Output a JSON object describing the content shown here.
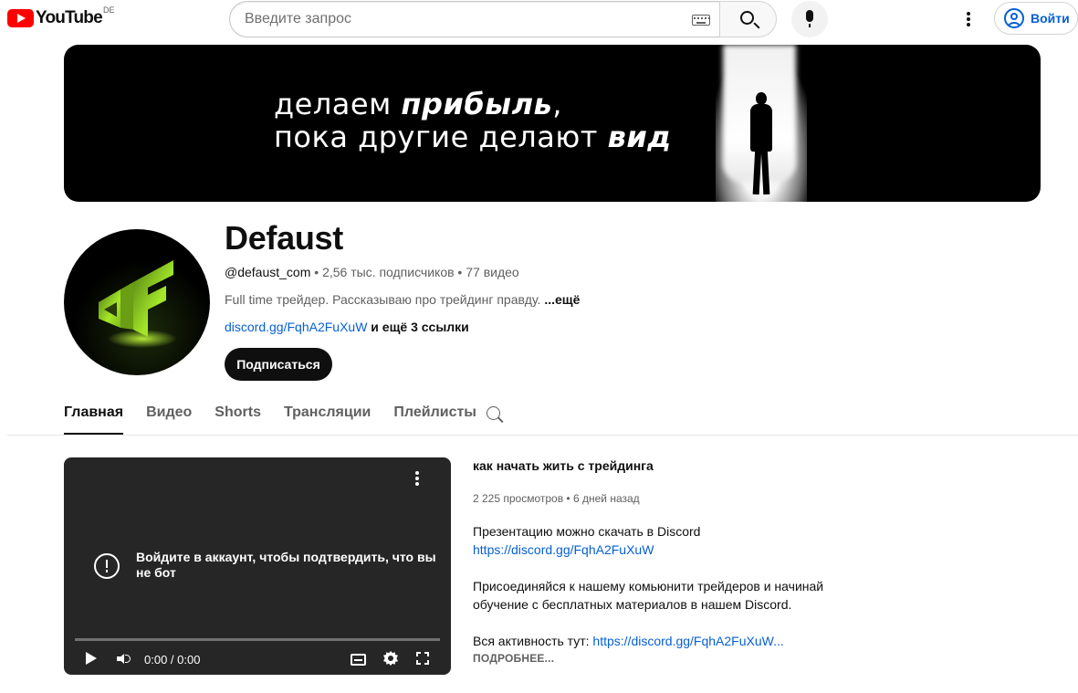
{
  "masthead": {
    "logo_text": "YouTube",
    "country_code": "DE",
    "search_placeholder": "Введите запрос",
    "signin_label": "Войти",
    "brand_color": "#ff0000",
    "accent_color": "#065fd4",
    "icons": [
      "youtube-logo-icon",
      "keyboard-icon",
      "search-icon",
      "mic-icon",
      "more-vertical-icon",
      "user-circle-icon"
    ]
  },
  "banner": {
    "line1_regular": "делаем ",
    "line1_bold": "прибыль",
    "line1_tail": ",",
    "line2_regular": "пока другие делают ",
    "line2_bold": "вид"
  },
  "channel": {
    "name": "Defaust",
    "handle": "@defaust_com",
    "separator": " • ",
    "subscribers": "2,56 тыс. подписчиков",
    "videos": "77 видео",
    "description": "Full time трейдер. Рассказываю про трейдинг правду. ",
    "more_label": "...ещё",
    "link": "discord.gg/FqhA2FuXuW",
    "more_links": " и ещё 3 ссылки",
    "subscribe_label": "Подписаться",
    "avatar_accent": "#a5e82a"
  },
  "tabs": [
    {
      "label": "Главная",
      "active": true
    },
    {
      "label": "Видео",
      "active": false
    },
    {
      "label": "Shorts",
      "active": false
    },
    {
      "label": "Трансляции",
      "active": false
    },
    {
      "label": "Плейлисты",
      "active": false
    }
  ],
  "player": {
    "message": "Войдите в аккаунт, чтобы подтвердить, что вы не бот",
    "time": "0:00 / 0:00",
    "progress": 0
  },
  "featured": {
    "title": "как начать жить с трейдинга",
    "views": "2 225 просмотров",
    "age": "6 дней назад",
    "desc_line1": "Презентацию можно скачать в Discord",
    "desc_link1": "https://discord.gg/FqhA2FuXuW",
    "desc_para2_line1": "Присоединяйся к нашему комьюнити трейдеров и начинай",
    "desc_para2_line2": "обучение с бесплатных материалов в нашем Discord.",
    "desc_line3": "Вся активность тут: ",
    "desc_link3": "https://discord.gg/FqhA2FuXuW...",
    "read_more": "ПОДРОБНЕЕ..."
  }
}
